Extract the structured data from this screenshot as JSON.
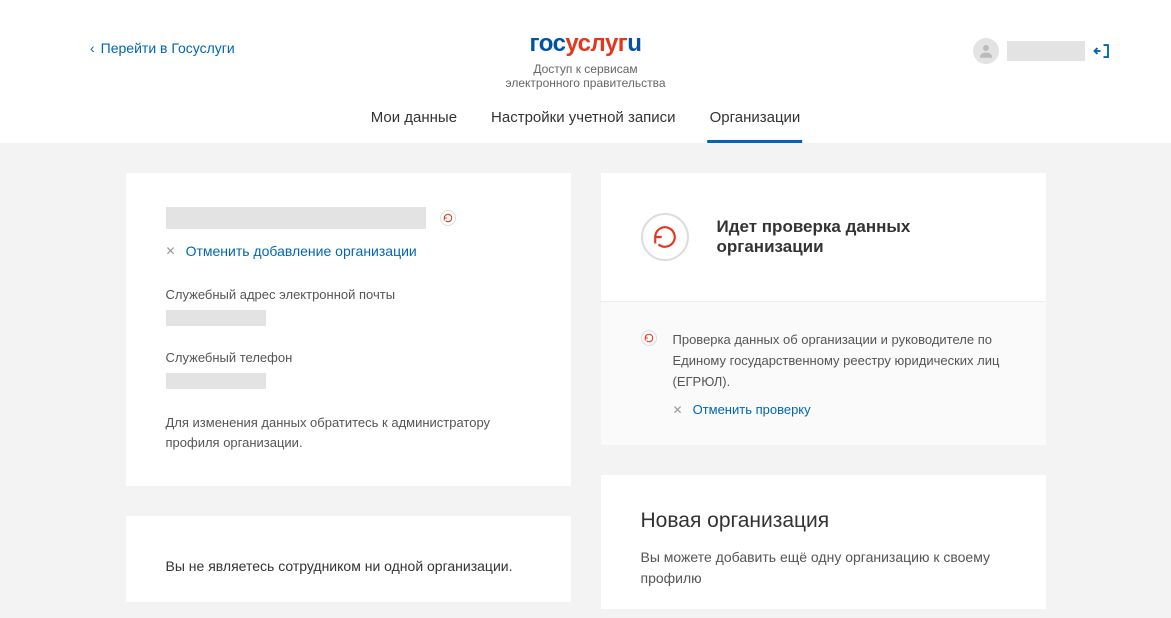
{
  "header": {
    "back_link": "Перейти в Госуслуги",
    "logo": {
      "gos": "гос",
      "usl": "услуг",
      "ugi": "u"
    },
    "subtitle1": "Доступ к сервисам",
    "subtitle2": "электронного правительства",
    "tabs": [
      "Мои данные",
      "Настройки учетной записи",
      "Организации"
    ]
  },
  "org_card": {
    "cancel_add": "Отменить добавление организации",
    "email_label": "Служебный адрес электронной почты",
    "phone_label": "Служебный телефон",
    "admin_note": "Для изменения данных обратитесь к администратору профиля организации."
  },
  "check_card": {
    "title": "Идет проверка данных организации",
    "body": "Проверка данных об организации и руководителе по Единому государственному реестру юридических лиц (ЕГРЮЛ).",
    "cancel": "Отменить проверку"
  },
  "employee_card": {
    "text": "Вы не являетесь сотрудником ни одной организации."
  },
  "new_org_card": {
    "title": "Новая организация",
    "text": "Вы можете добавить ещё одну организацию к своему профилю"
  }
}
